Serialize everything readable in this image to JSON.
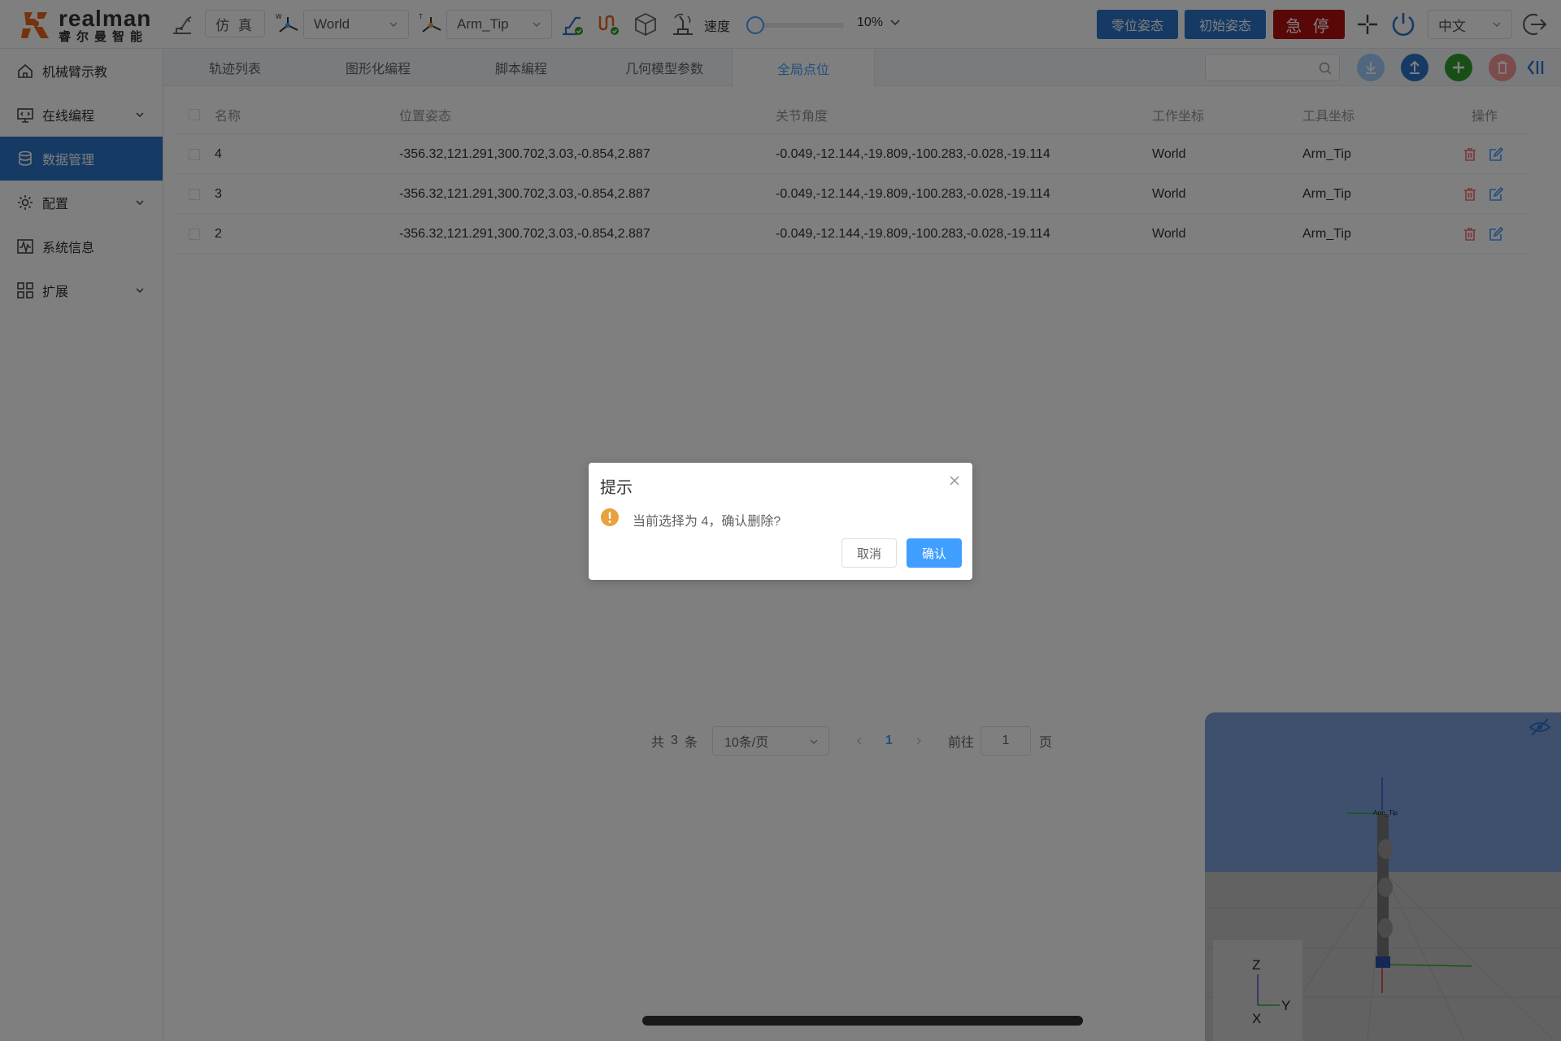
{
  "brand": {
    "name_en": "realman",
    "name_cn": "睿尔曼智能"
  },
  "toolbar": {
    "sim_label": "仿 真",
    "frame_select": "World",
    "tool_select": "Arm_Tip",
    "speed_label": "速度",
    "speed_value": "10%",
    "speed_fraction": 0.1,
    "zero_pose_label": "零位姿态",
    "init_pose_label": "初始姿态",
    "estop_label": "急 停",
    "language": "中文"
  },
  "sidebar": {
    "items": [
      {
        "label": "机械臂示教",
        "icon": "home-icon",
        "expandable": false,
        "active": false
      },
      {
        "label": "在线编程",
        "icon": "monitor-code-icon",
        "expandable": true,
        "active": false
      },
      {
        "label": "数据管理",
        "icon": "database-icon",
        "expandable": false,
        "active": true
      },
      {
        "label": "配置",
        "icon": "settings-icon",
        "expandable": true,
        "active": false
      },
      {
        "label": "系统信息",
        "icon": "waveform-icon",
        "expandable": false,
        "active": false
      },
      {
        "label": "扩展",
        "icon": "grid-icon",
        "expandable": true,
        "active": false
      }
    ]
  },
  "tabs": [
    {
      "label": "轨迹列表",
      "active": false
    },
    {
      "label": "图形化编程",
      "active": false
    },
    {
      "label": "脚本编程",
      "active": false
    },
    {
      "label": "几何模型参数",
      "active": false
    },
    {
      "label": "全局点位",
      "active": true
    }
  ],
  "search": {
    "placeholder": "",
    "value": ""
  },
  "table": {
    "columns": [
      "名称",
      "位置姿态",
      "关节角度",
      "工作坐标",
      "工具坐标",
      "操作"
    ],
    "rows": [
      {
        "name": "4",
        "pose": "-356.32,121.291,300.702,3.03,-0.854,2.887",
        "joints": "-0.049,-12.144,-19.809,-100.283,-0.028,-19.114",
        "work": "World",
        "tool": "Arm_Tip"
      },
      {
        "name": "3",
        "pose": "-356.32,121.291,300.702,3.03,-0.854,2.887",
        "joints": "-0.049,-12.144,-19.809,-100.283,-0.028,-19.114",
        "work": "World",
        "tool": "Arm_Tip"
      },
      {
        "name": "2",
        "pose": "-356.32,121.291,300.702,3.03,-0.854,2.887",
        "joints": "-0.049,-12.144,-19.809,-100.283,-0.028,-19.114",
        "work": "World",
        "tool": "Arm_Tip"
      }
    ]
  },
  "pagination": {
    "total_prefix": "共",
    "total_count": "3",
    "total_suffix": "条",
    "page_size": "10条/页",
    "current_page": "1",
    "goto_prefix": "前往",
    "goto_value": "1",
    "goto_suffix": "页"
  },
  "viewer": {
    "tool_label": "Arm_Tip",
    "axis_z": "Z",
    "axis_y": "Y",
    "axis_x": "X"
  },
  "dialog": {
    "title": "提示",
    "message": "当前选择为 4，确认删除?",
    "cancel_label": "取消",
    "confirm_label": "确认"
  },
  "colors": {
    "primary": "#409eff",
    "brand_blue": "#2b74c9",
    "estop_red": "#b40f0f",
    "logo_orange": "#e8641b",
    "delete_red": "#f56c6c",
    "add_green": "#2e9e2e",
    "warning": "#e6a23c"
  }
}
